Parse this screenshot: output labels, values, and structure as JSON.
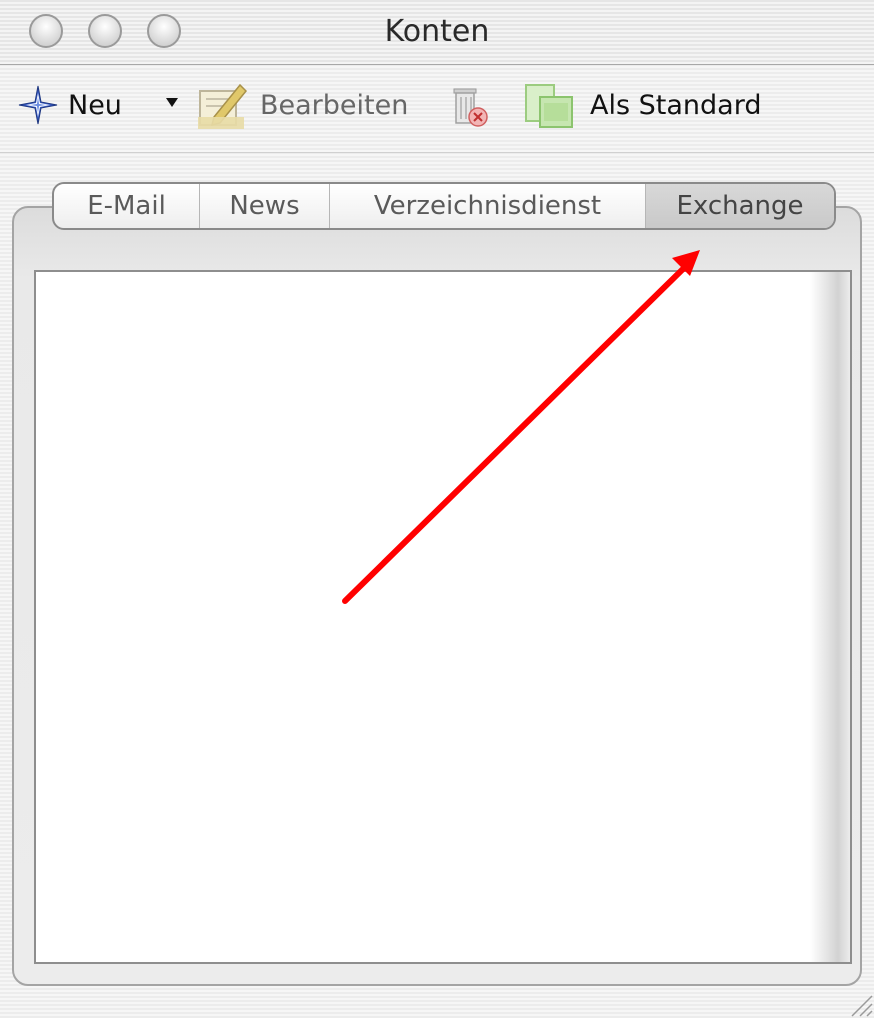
{
  "window": {
    "title": "Konten"
  },
  "toolbar": {
    "new_label": "Neu",
    "edit_label": "Bearbeiten",
    "default_label": "Als Standard"
  },
  "tabs": [
    {
      "label": "E-Mail",
      "active": false
    },
    {
      "label": "News",
      "active": false
    },
    {
      "label": "Verzeichnisdienst",
      "active": false
    },
    {
      "label": "Exchange",
      "active": true
    }
  ],
  "icons": {
    "new": "compass-star-icon",
    "edit": "edit-document-icon",
    "delete": "trash-icon",
    "default": "set-default-icon",
    "annotation": "red-arrow-annotation"
  },
  "colors": {
    "annotation": "#ff0000",
    "new_icon": "#3a5ec8"
  }
}
